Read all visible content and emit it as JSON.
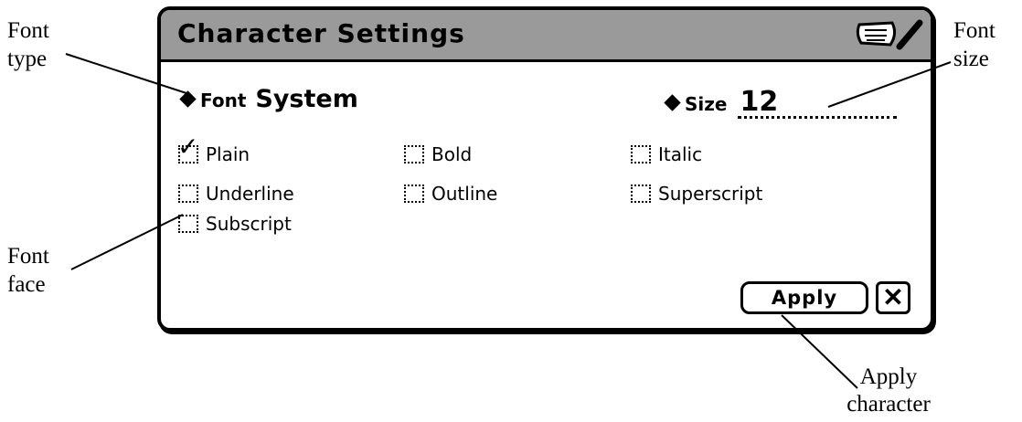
{
  "callouts": {
    "font_type_1": "Font",
    "font_type_2": "type",
    "font_size_1": "Font",
    "font_size_2": "size",
    "font_face_1": "Font",
    "font_face_2": "face",
    "apply_1": "Apply",
    "apply_2": "character"
  },
  "window": {
    "title": "Character Settings",
    "icons": [
      "keyboard-icon",
      "pencil-icon"
    ]
  },
  "font": {
    "label": "Font",
    "value": "System"
  },
  "size": {
    "label": "Size",
    "value": "12"
  },
  "styles": [
    {
      "label": "Plain",
      "checked": true
    },
    {
      "label": "Bold",
      "checked": false
    },
    {
      "label": "Italic",
      "checked": false
    },
    {
      "label": "Underline",
      "checked": false
    },
    {
      "label": "Outline",
      "checked": false
    },
    {
      "label": "Superscript",
      "checked": false
    },
    {
      "label": "Subscript",
      "checked": false
    }
  ],
  "buttons": {
    "apply": "Apply",
    "close": "✕"
  }
}
